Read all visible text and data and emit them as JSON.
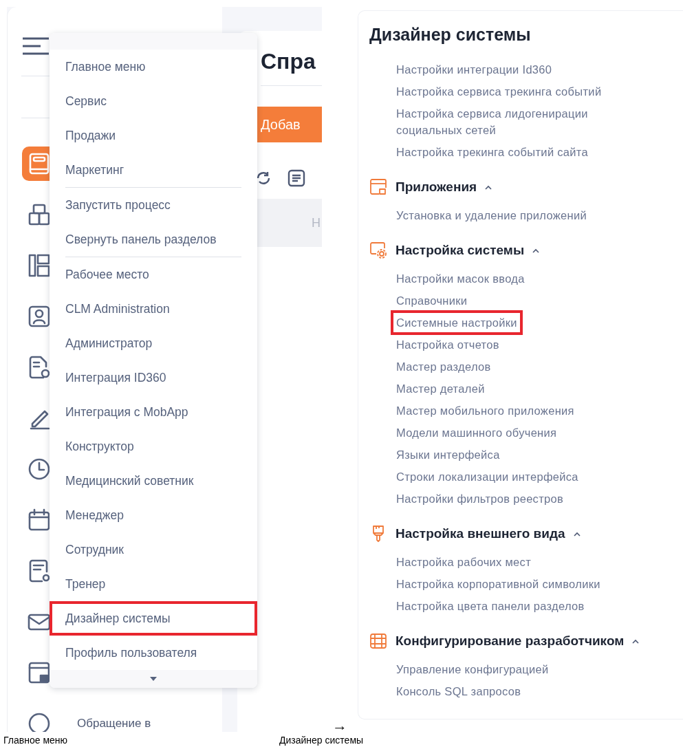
{
  "left_screen": {
    "sidebar": {
      "items": [
        {
          "kind": "book",
          "selected": true
        },
        {
          "kind": "boxes",
          "selected": false
        },
        {
          "kind": "layout",
          "selected": false
        },
        {
          "kind": "contact",
          "selected": false
        },
        {
          "kind": "document",
          "selected": false
        },
        {
          "kind": "pencil",
          "selected": false
        },
        {
          "kind": "clock",
          "selected": false
        },
        {
          "kind": "calendar",
          "selected": false
        },
        {
          "kind": "doc-gear",
          "selected": false
        },
        {
          "kind": "mail",
          "selected": false
        },
        {
          "kind": "window",
          "selected": false
        },
        {
          "kind": "circle",
          "selected": false,
          "label": "Обращение в"
        }
      ]
    },
    "page_title": "Спра",
    "add_button": "Добав",
    "column_header": "Н",
    "menu": {
      "groups": [
        {
          "items": [
            {
              "label": "Главное меню",
              "highlighted": false
            },
            {
              "label": "Сервис",
              "highlighted": false
            },
            {
              "label": "Продажи",
              "highlighted": false
            },
            {
              "label": "Маркетинг",
              "highlighted": false
            }
          ]
        },
        {
          "items": [
            {
              "label": "Запустить процесс",
              "highlighted": false
            },
            {
              "label": "Свернуть панель разделов",
              "highlighted": false
            }
          ]
        },
        {
          "items": [
            {
              "label": "Рабочее место",
              "highlighted": false
            },
            {
              "label": "CLM Administration",
              "highlighted": false
            },
            {
              "label": "Администратор",
              "highlighted": false
            },
            {
              "label": "Интеграция ID360",
              "highlighted": false
            },
            {
              "label": "Интеграция с MobApp",
              "highlighted": false
            },
            {
              "label": "Конструктор",
              "highlighted": false
            },
            {
              "label": "Медицинский советник",
              "highlighted": false
            },
            {
              "label": "Менеджер",
              "highlighted": false
            },
            {
              "label": "Сотрудник",
              "highlighted": false
            },
            {
              "label": "Тренер",
              "highlighted": false
            },
            {
              "label": "Дизайнер системы",
              "highlighted": true
            },
            {
              "label": "Профиль пользователя",
              "highlighted": false
            }
          ]
        }
      ]
    }
  },
  "arrow": "→",
  "right_screen": {
    "title": "Дизайнер системы",
    "sections": [
      {
        "items": [
          {
            "label": "Настройки интеграции Id360",
            "highlighted": false
          },
          {
            "label": "Настройка сервиса трекинга событий",
            "highlighted": false
          },
          {
            "label": "Настройка сервиса лидогенирации социальных сетей",
            "highlighted": false
          },
          {
            "label": "Настройка трекинга событий сайта",
            "highlighted": false
          }
        ]
      },
      {
        "kind": "apps",
        "title": "Приложения",
        "expanded": true,
        "items": [
          {
            "label": "Установка и удаление приложений",
            "highlighted": false
          }
        ]
      },
      {
        "kind": "gear",
        "title": "Настройка системы",
        "expanded": true,
        "items": [
          {
            "label": "Настройки масок ввода",
            "highlighted": false
          },
          {
            "label": "Справочники",
            "highlighted": false
          },
          {
            "label": "Системные настройки",
            "highlighted": true
          },
          {
            "label": "Настройка отчетов",
            "highlighted": false
          },
          {
            "label": "Мастер разделов",
            "highlighted": false
          },
          {
            "label": "Мастер деталей",
            "highlighted": false
          },
          {
            "label": "Мастер мобильного приложения",
            "highlighted": false
          },
          {
            "label": "Модели машинного обучения",
            "highlighted": false
          },
          {
            "label": "Языки интерфейса",
            "highlighted": false
          },
          {
            "label": "Строки локализации интерфейса",
            "highlighted": false
          },
          {
            "label": "Настройки фильтров реестров",
            "highlighted": false
          }
        ]
      },
      {
        "kind": "brush",
        "title": "Настройка внешнего вида",
        "expanded": true,
        "items": [
          {
            "label": "Настройка рабочих мест",
            "highlighted": false
          },
          {
            "label": "Настройка корпоративной символики",
            "highlighted": false
          },
          {
            "label": "Настройка цвета панели разделов",
            "highlighted": false
          }
        ]
      },
      {
        "kind": "grid",
        "title": "Конфигурирование разработчиком",
        "expanded": true,
        "items": [
          {
            "label": "Управление конфигурацией",
            "highlighted": false
          },
          {
            "label": "Консоль SQL запросов",
            "highlighted": false
          }
        ]
      }
    ]
  },
  "captions": [
    "Главное меню",
    "Дизайнер системы"
  ]
}
